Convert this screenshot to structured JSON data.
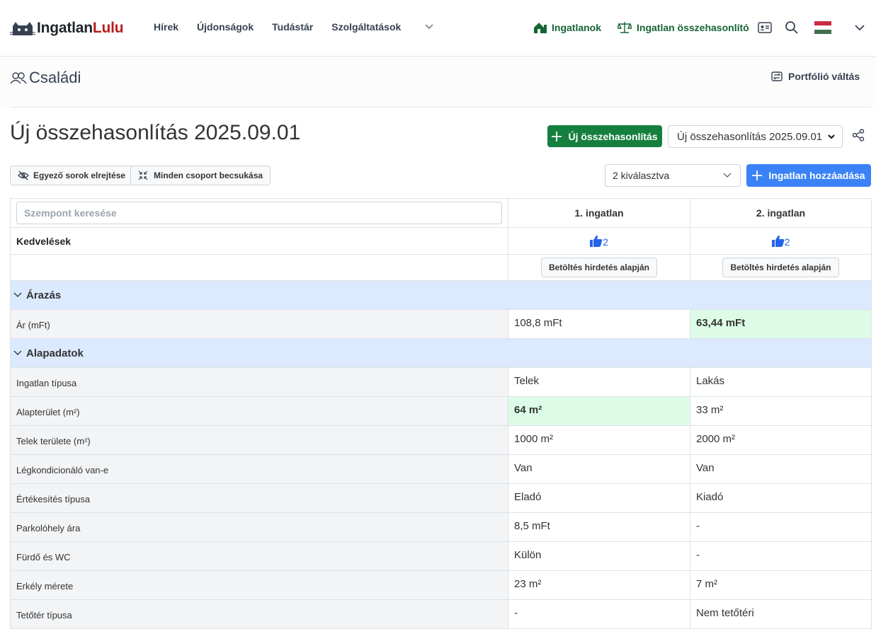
{
  "nav": {
    "logo_part1": "Ingatlan",
    "logo_part2": "Lulu",
    "links": [
      "Hírek",
      "Újdonságok",
      "Tudástár",
      "Szolgáltatások"
    ],
    "ingatlanok": "Ingatlanok",
    "compare": "Ingatlan összehasonlító",
    "accent": "#166534"
  },
  "portfolio": {
    "name": "Családi",
    "switch_label": "Portfólió váltás"
  },
  "comparison": {
    "title": "Új összehasonlítás 2025.09.01",
    "new_button": "Új összehasonlítás",
    "selected": "Új összehasonlítás 2025.09.01"
  },
  "toolbar": {
    "hide_same": "Egyező sorok elrejtése",
    "collapse_all": "Minden csoport becsukása",
    "selected_count": "2 kiválasztva",
    "add_property": "Ingatlan hozzáadása"
  },
  "table": {
    "search_placeholder": "Szempont keresése",
    "columns": [
      "1. ingatlan",
      "2. ingatlan"
    ],
    "likes_label": "Kedvelések",
    "likes": [
      "2",
      "2"
    ],
    "load_button": "Betöltés hirdetés alapján",
    "groups": [
      {
        "name": "Árazás",
        "rows": [
          {
            "label": "Ár (mFt)",
            "values": [
              "108,8 mFt",
              "63,44 mFt"
            ],
            "best": 1
          }
        ]
      },
      {
        "name": "Alapadatok",
        "rows": [
          {
            "label": "Ingatlan típusa",
            "values": [
              "Telek",
              "Lakás"
            ],
            "best": -1
          },
          {
            "label": "Alapterület (m²)",
            "values": [
              "64 m²",
              "33 m²"
            ],
            "best": 0
          },
          {
            "label": "Telek területe (m²)",
            "values": [
              "1000 m²",
              "2000 m²"
            ],
            "best": -1
          },
          {
            "label": "Légkondicionáló van-e",
            "values": [
              "Van",
              "Van"
            ],
            "best": -1
          },
          {
            "label": "Értékesítés típusa",
            "values": [
              "Eladó",
              "Kiadó"
            ],
            "best": -1
          },
          {
            "label": "Parkolóhely ára",
            "values": [
              "8,5 mFt",
              "-"
            ],
            "best": -1
          },
          {
            "label": "Fürdő és WC",
            "values": [
              "Külön",
              "-"
            ],
            "best": -1
          },
          {
            "label": "Erkély mérete",
            "values": [
              "23 m²",
              "7 m²"
            ],
            "best": -1
          },
          {
            "label": "Tetőtér típusa",
            "values": [
              "-",
              "Nem tetőtéri"
            ],
            "best": -1
          }
        ]
      }
    ]
  }
}
